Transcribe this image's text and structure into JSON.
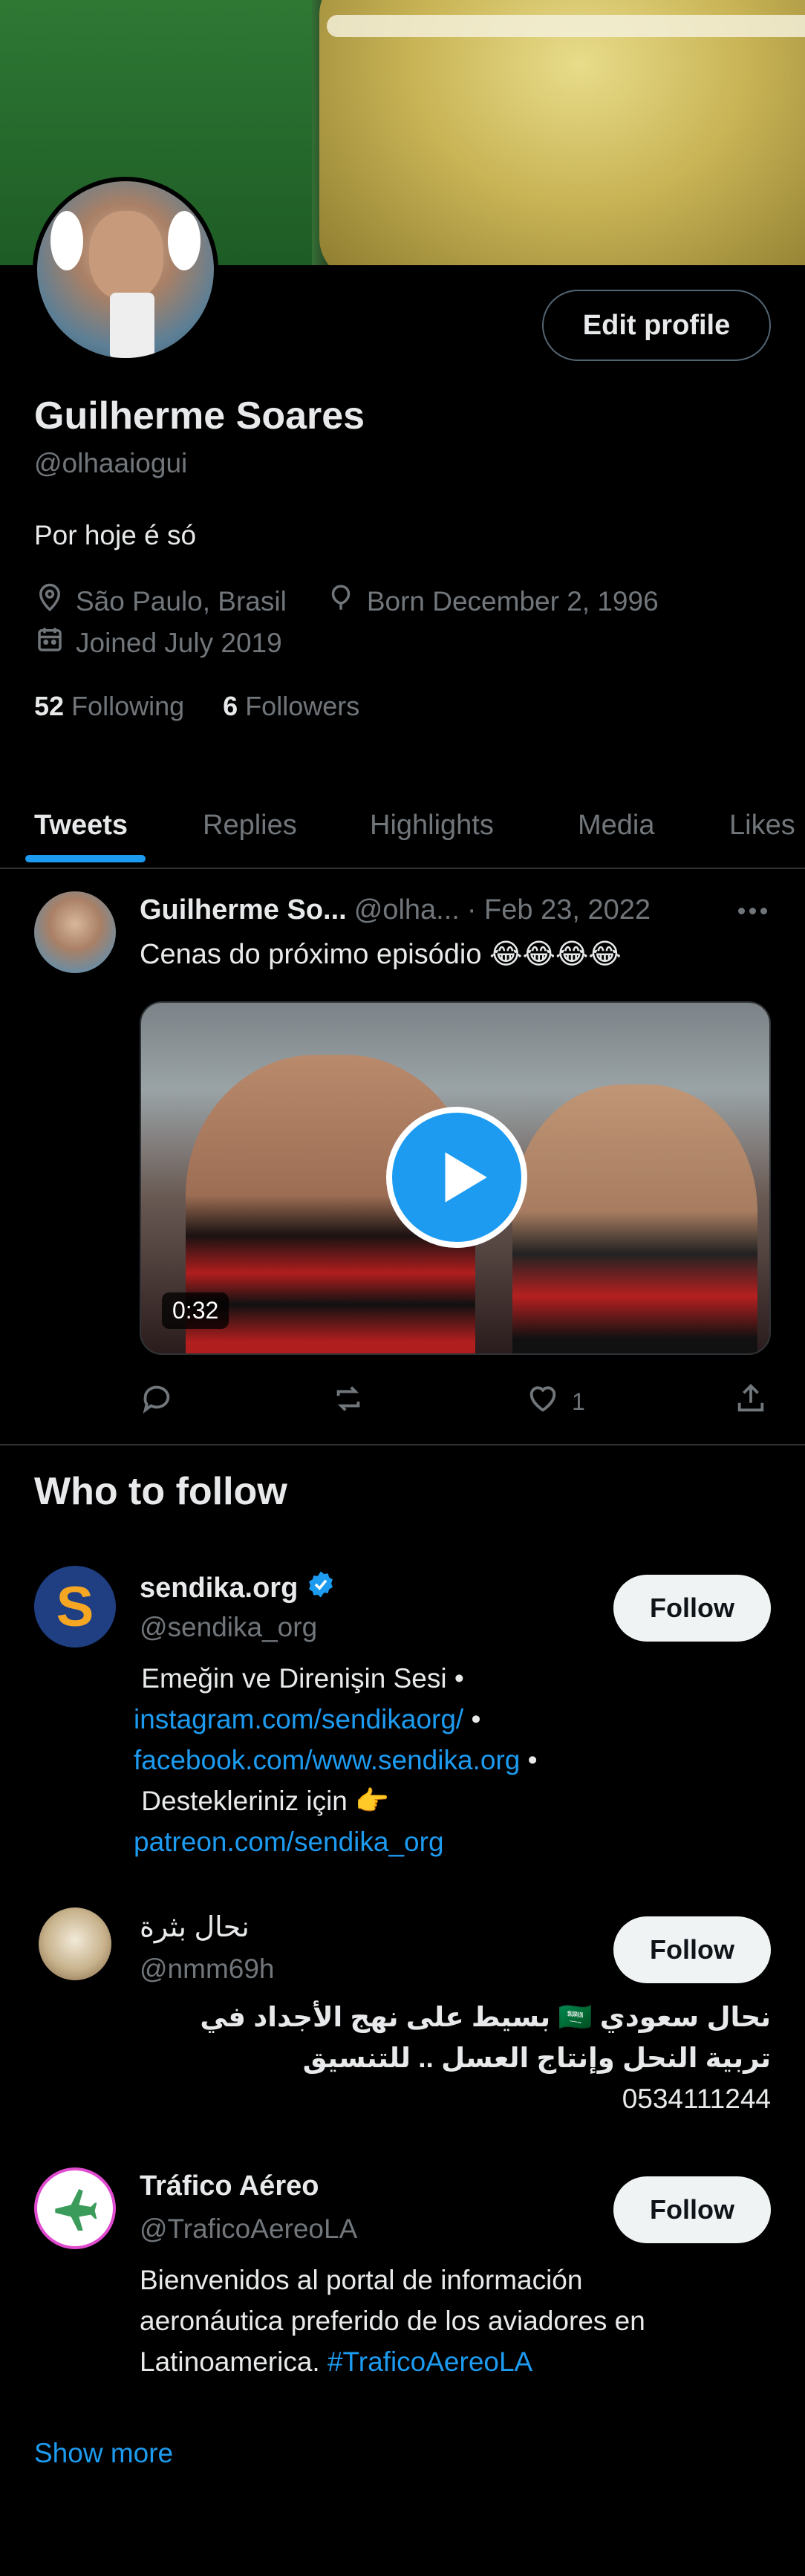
{
  "profile": {
    "name": "Guilherme Soares",
    "handle": "@olhaaiogui",
    "bio": "Por hoje é só",
    "location": "São Paulo, Brasil",
    "born": "Born December 2, 1996",
    "joined": "Joined July 2019",
    "following_count": "52",
    "following_label": "Following",
    "followers_count": "6",
    "followers_label": "Followers",
    "edit_label": "Edit profile"
  },
  "tabs": [
    "Tweets",
    "Replies",
    "Highlights",
    "Media",
    "Likes"
  ],
  "tweet": {
    "author": "Guilherme So...",
    "handle": "@olha...",
    "date": "· Feb 23, 2022",
    "text": "Cenas do próximo episódio 😂😂😂😂",
    "video_duration": "0:32",
    "like_count": "1"
  },
  "who_to_follow": {
    "title": "Who to follow",
    "follow_label": "Follow",
    "accounts": [
      {
        "name": "sendika.org",
        "handle": "@sendika_org",
        "bio_l1": "Emeğin ve Direnişin Sesi •",
        "bio_l2_link": "instagram.com/sendikaorg/",
        "bio_l2_rest": " •",
        "bio_l3_link": "facebook.com/www.sendika.org",
        "bio_l3_rest": " •",
        "bio_l4": "Destekleriniz için 👉",
        "bio_l5_link": "patreon.com/sendika_org"
      },
      {
        "name": "نحال بثرة",
        "handle": "@nmm69h",
        "bio_l1": "نحال سعودي 🇸🇦 بسيط على نهج الأجداد في",
        "bio_l2": "تربية النحل وإنتاج العسل .. للتنسيق",
        "bio_l3": "0534111244"
      },
      {
        "name": "Tráfico Aéreo",
        "handle": "@TraficoAereoLA",
        "bio_l1": "Bienvenidos al portal de información",
        "bio_l2": "aeronáutica preferido de los aviadores en",
        "bio_l3": "Latinoamerica. ",
        "bio_l3_link": "#TraficoAereoLA"
      }
    ],
    "show_more": "Show more"
  },
  "colors": {
    "accent": "#1d9bf0",
    "background": "#000000",
    "text": "#e7e9ea",
    "secondary_text": "#71767b"
  }
}
